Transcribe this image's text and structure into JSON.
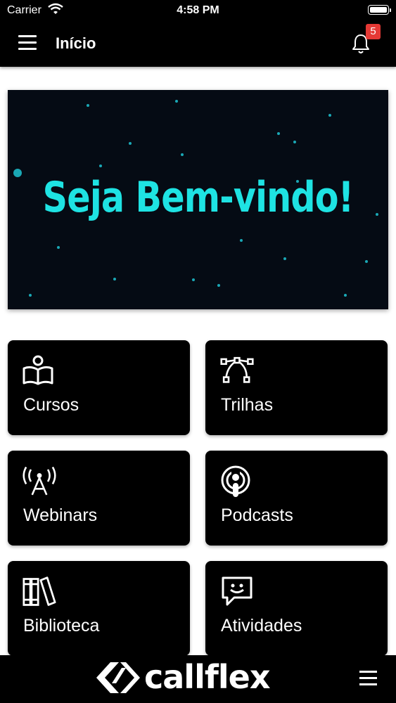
{
  "status": {
    "carrier": "Carrier",
    "time": "4:58 PM"
  },
  "header": {
    "title": "Início",
    "notification_count": "5"
  },
  "banner": {
    "text": "Seja Bem-vindo!"
  },
  "tiles": [
    {
      "label": "Cursos",
      "icon": "book-reader-icon"
    },
    {
      "label": "Trilhas",
      "icon": "vector-path-icon"
    },
    {
      "label": "Webinars",
      "icon": "broadcast-tower-icon"
    },
    {
      "label": "Podcasts",
      "icon": "podcast-icon"
    },
    {
      "label": "Biblioteca",
      "icon": "library-books-icon"
    },
    {
      "label": "Atividades",
      "icon": "chat-smile-icon"
    }
  ],
  "footer": {
    "brand": "callflex"
  },
  "colors": {
    "accent": "#1ee3e3",
    "badge": "#e53935",
    "tile": "#000000"
  }
}
